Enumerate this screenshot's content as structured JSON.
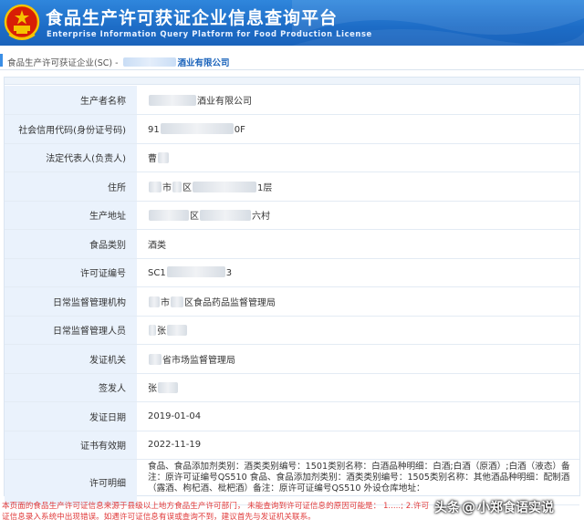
{
  "header": {
    "title": "食品生产许可获证企业信息查询平台",
    "subtitle": "Enterprise Information Query Platform for Food Production License",
    "emblem_icon": "national-emblem-icon",
    "bg_color": "#1d6cc6"
  },
  "breadcrumb": {
    "prefix": "食品生产许可获证企业(SC) - ",
    "company": "酒业有限公司"
  },
  "rows": [
    {
      "label": "生产者名称",
      "value": "酒业有限公司"
    },
    {
      "label": "社会信用代码(身份证号码)",
      "value_start": "91",
      "value_end": "0F"
    },
    {
      "label": "法定代表人(负责人)",
      "value": "曹"
    },
    {
      "label": "住所",
      "value_mid1": "市",
      "value_mid2": "区",
      "value_end": "1层"
    },
    {
      "label": "生产地址",
      "value_mid": "区",
      "value_end": "六村"
    },
    {
      "label": "食品类别",
      "value": "酒类"
    },
    {
      "label": "许可证编号",
      "value_start": "SC1",
      "value_end": "3"
    },
    {
      "label": "日常监督管理机构",
      "value_mid": "市",
      "value_end": "区食品药品监督管理局"
    },
    {
      "label": "日常监督管理人员",
      "value": "张"
    },
    {
      "label": "发证机关",
      "value_end": "省市场监督管理局"
    },
    {
      "label": "签发人",
      "value": "张"
    },
    {
      "label": "发证日期",
      "value": "2019-01-04"
    },
    {
      "label": "证书有效期",
      "value": "2022-11-19"
    },
    {
      "label": "许可明细",
      "value": "食品、食品添加剂类别：酒类类别编号：1501类别名称：白酒品种明细：白酒;白酒（原酒）;白酒（液态）备注：原许可证编号QS510 食品、食品添加剂类别：酒类类别编号：1505类别名称：其他酒品种明细：配制酒（露酒、枸杞酒、枇杷酒）备注：原许可证编号QS510 外设仓库地址："
    }
  ],
  "notice": "本页面的食品生产许可证信息来源于县级以上地方食品生产许可部门， 未能查询到许可证信息的原因可能是： 1.....; 2.许可证信息录入系统中出现错误。如遇许可证信息有误或查询不到，建议首先与发证机关联系。",
  "watermark": {
    "text_left": "头条",
    "text_right": "小郑食语实说",
    "icon": "at-icon"
  }
}
